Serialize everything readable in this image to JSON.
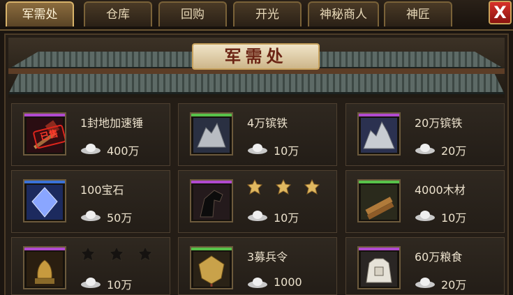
{
  "tabs": [
    {
      "label": "军需处",
      "active": true
    },
    {
      "label": "仓库"
    },
    {
      "label": "回购"
    },
    {
      "label": "开光"
    },
    {
      "label": "神秘商人"
    },
    {
      "label": "神匠"
    }
  ],
  "close_label": "X",
  "title": "军需处",
  "items": [
    {
      "name": "1封地加速锤",
      "price": "400万",
      "rarity_color": "#b14ad0",
      "icon": "hammer-icon",
      "stamp": "已售"
    },
    {
      "name": "4万镔铁",
      "price": "10万",
      "rarity_color": "#58c24a",
      "icon": "iron-ore-icon"
    },
    {
      "name": "20万镔铁",
      "price": "20万",
      "rarity_color": "#b14ad0",
      "icon": "iron-ore-icon"
    },
    {
      "name": "100宝石",
      "price": "50万",
      "rarity_color": "#3a72d8",
      "icon": "gem-icon"
    },
    {
      "name": "",
      "price": "10万",
      "rarity_color": "#b14ad0",
      "icon": "horse-icon",
      "stars": 3,
      "stars_lit": 3
    },
    {
      "name": "4000木材",
      "price": "10万",
      "rarity_color": "#58c24a",
      "icon": "wood-icon"
    },
    {
      "name": "",
      "price": "10万",
      "rarity_color": "#b14ad0",
      "icon": "dragon-statue-icon",
      "stars": 3,
      "stars_lit": 0
    },
    {
      "name": "3募兵令",
      "price": "1000",
      "rarity_color": "#58c24a",
      "icon": "recruit-token-icon"
    },
    {
      "name": "60万粮食",
      "price": "20万",
      "rarity_color": "#b14ad0",
      "icon": "grain-sack-icon"
    }
  ]
}
